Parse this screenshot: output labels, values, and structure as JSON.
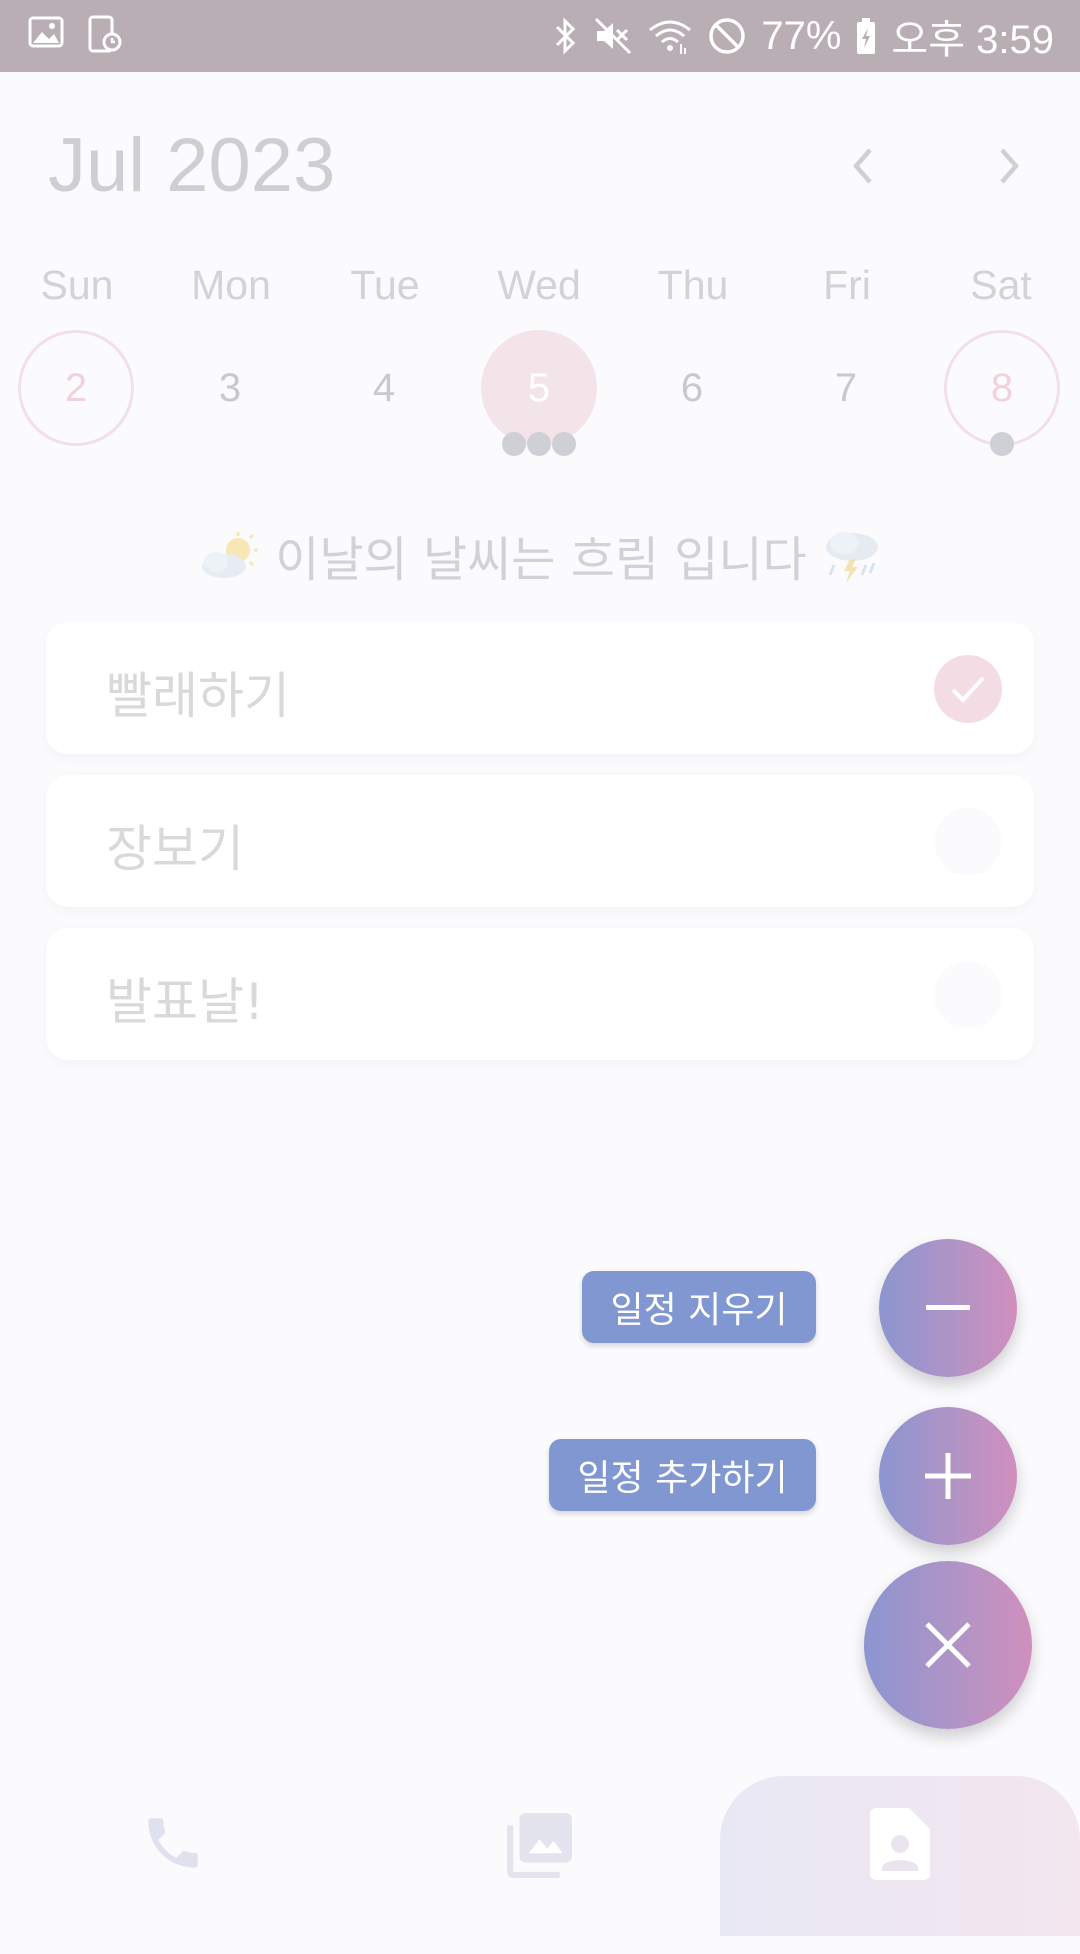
{
  "status_bar": {
    "battery": "77%",
    "time": "오후 3:59",
    "icons": [
      "image-icon",
      "screen-record-icon",
      "bluetooth-icon",
      "mute-icon",
      "wifi-icon",
      "do-not-disturb-icon",
      "battery-icon"
    ]
  },
  "calendar": {
    "month_title": "Jul 2023",
    "weekdays": [
      "Sun",
      "Mon",
      "Tue",
      "Wed",
      "Thu",
      "Fri",
      "Sat"
    ],
    "days": [
      "2",
      "3",
      "4",
      "5",
      "6",
      "7",
      "8"
    ],
    "selected_day": "5"
  },
  "weather": {
    "text": "이날의 날씨는 흐림 입니다"
  },
  "tasks": [
    {
      "title": "빨래하기",
      "done": true
    },
    {
      "title": "장보기",
      "done": false
    },
    {
      "title": "발표날!",
      "done": false
    }
  ],
  "fab": {
    "delete_label": "일정 지우기",
    "add_label": "일정 추가하기"
  },
  "bottom_nav": {
    "items": [
      "phone-icon",
      "gallery-icon",
      "contact-document-icon"
    ],
    "active": "contact-document-icon"
  },
  "colors": {
    "status_bar": "#b8aeb3",
    "fab_label": "#8097d2",
    "gradient_start": "#8c95d0",
    "gradient_end": "#d08fbd"
  }
}
